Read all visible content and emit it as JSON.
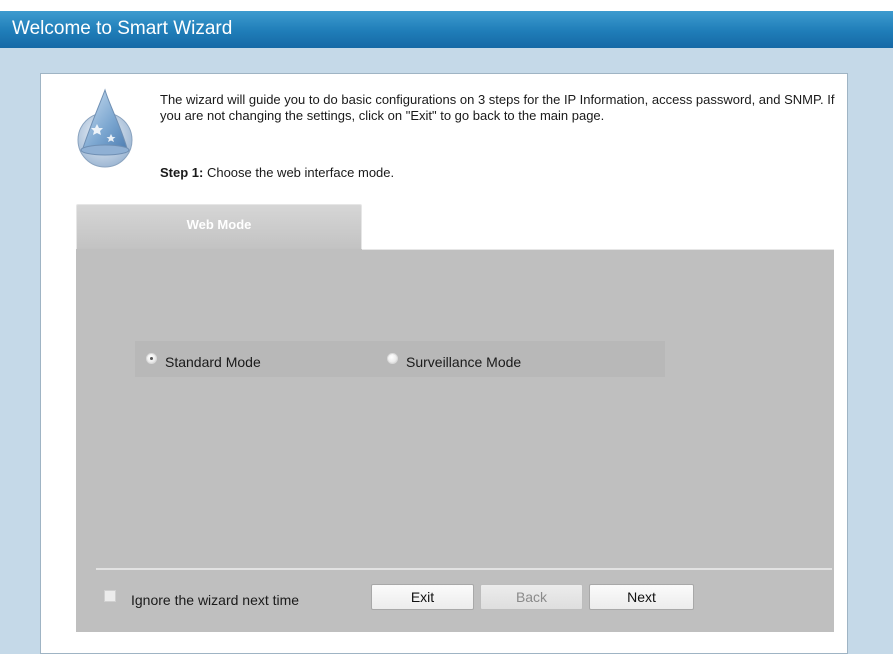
{
  "window": {
    "title": "Welcome to Smart Wizard"
  },
  "intro": {
    "text": "The wizard will guide you to do basic configurations on 3 steps for the IP Information, access password, and SNMP. If you are not changing the settings, click on \"Exit\" to go back to the main page.",
    "step_label": "Step 1:",
    "step_text": " Choose the web interface mode."
  },
  "tabs": [
    {
      "label": "Web Mode",
      "selected": true
    }
  ],
  "modes": {
    "options": [
      {
        "label": "Standard Mode",
        "selected": true
      },
      {
        "label": "Surveillance Mode",
        "selected": false
      }
    ]
  },
  "footer": {
    "ignore_label": "Ignore the wizard next time",
    "ignore_checked": false,
    "exit_label": "Exit",
    "back_label": "Back",
    "back_enabled": false,
    "next_label": "Next"
  },
  "colors": {
    "titlebar": "#1f7db8",
    "background": "#c5d9e8",
    "tab_panel": "#bfbfbf"
  },
  "icons": {
    "wizard": "wizard-hat-icon"
  }
}
